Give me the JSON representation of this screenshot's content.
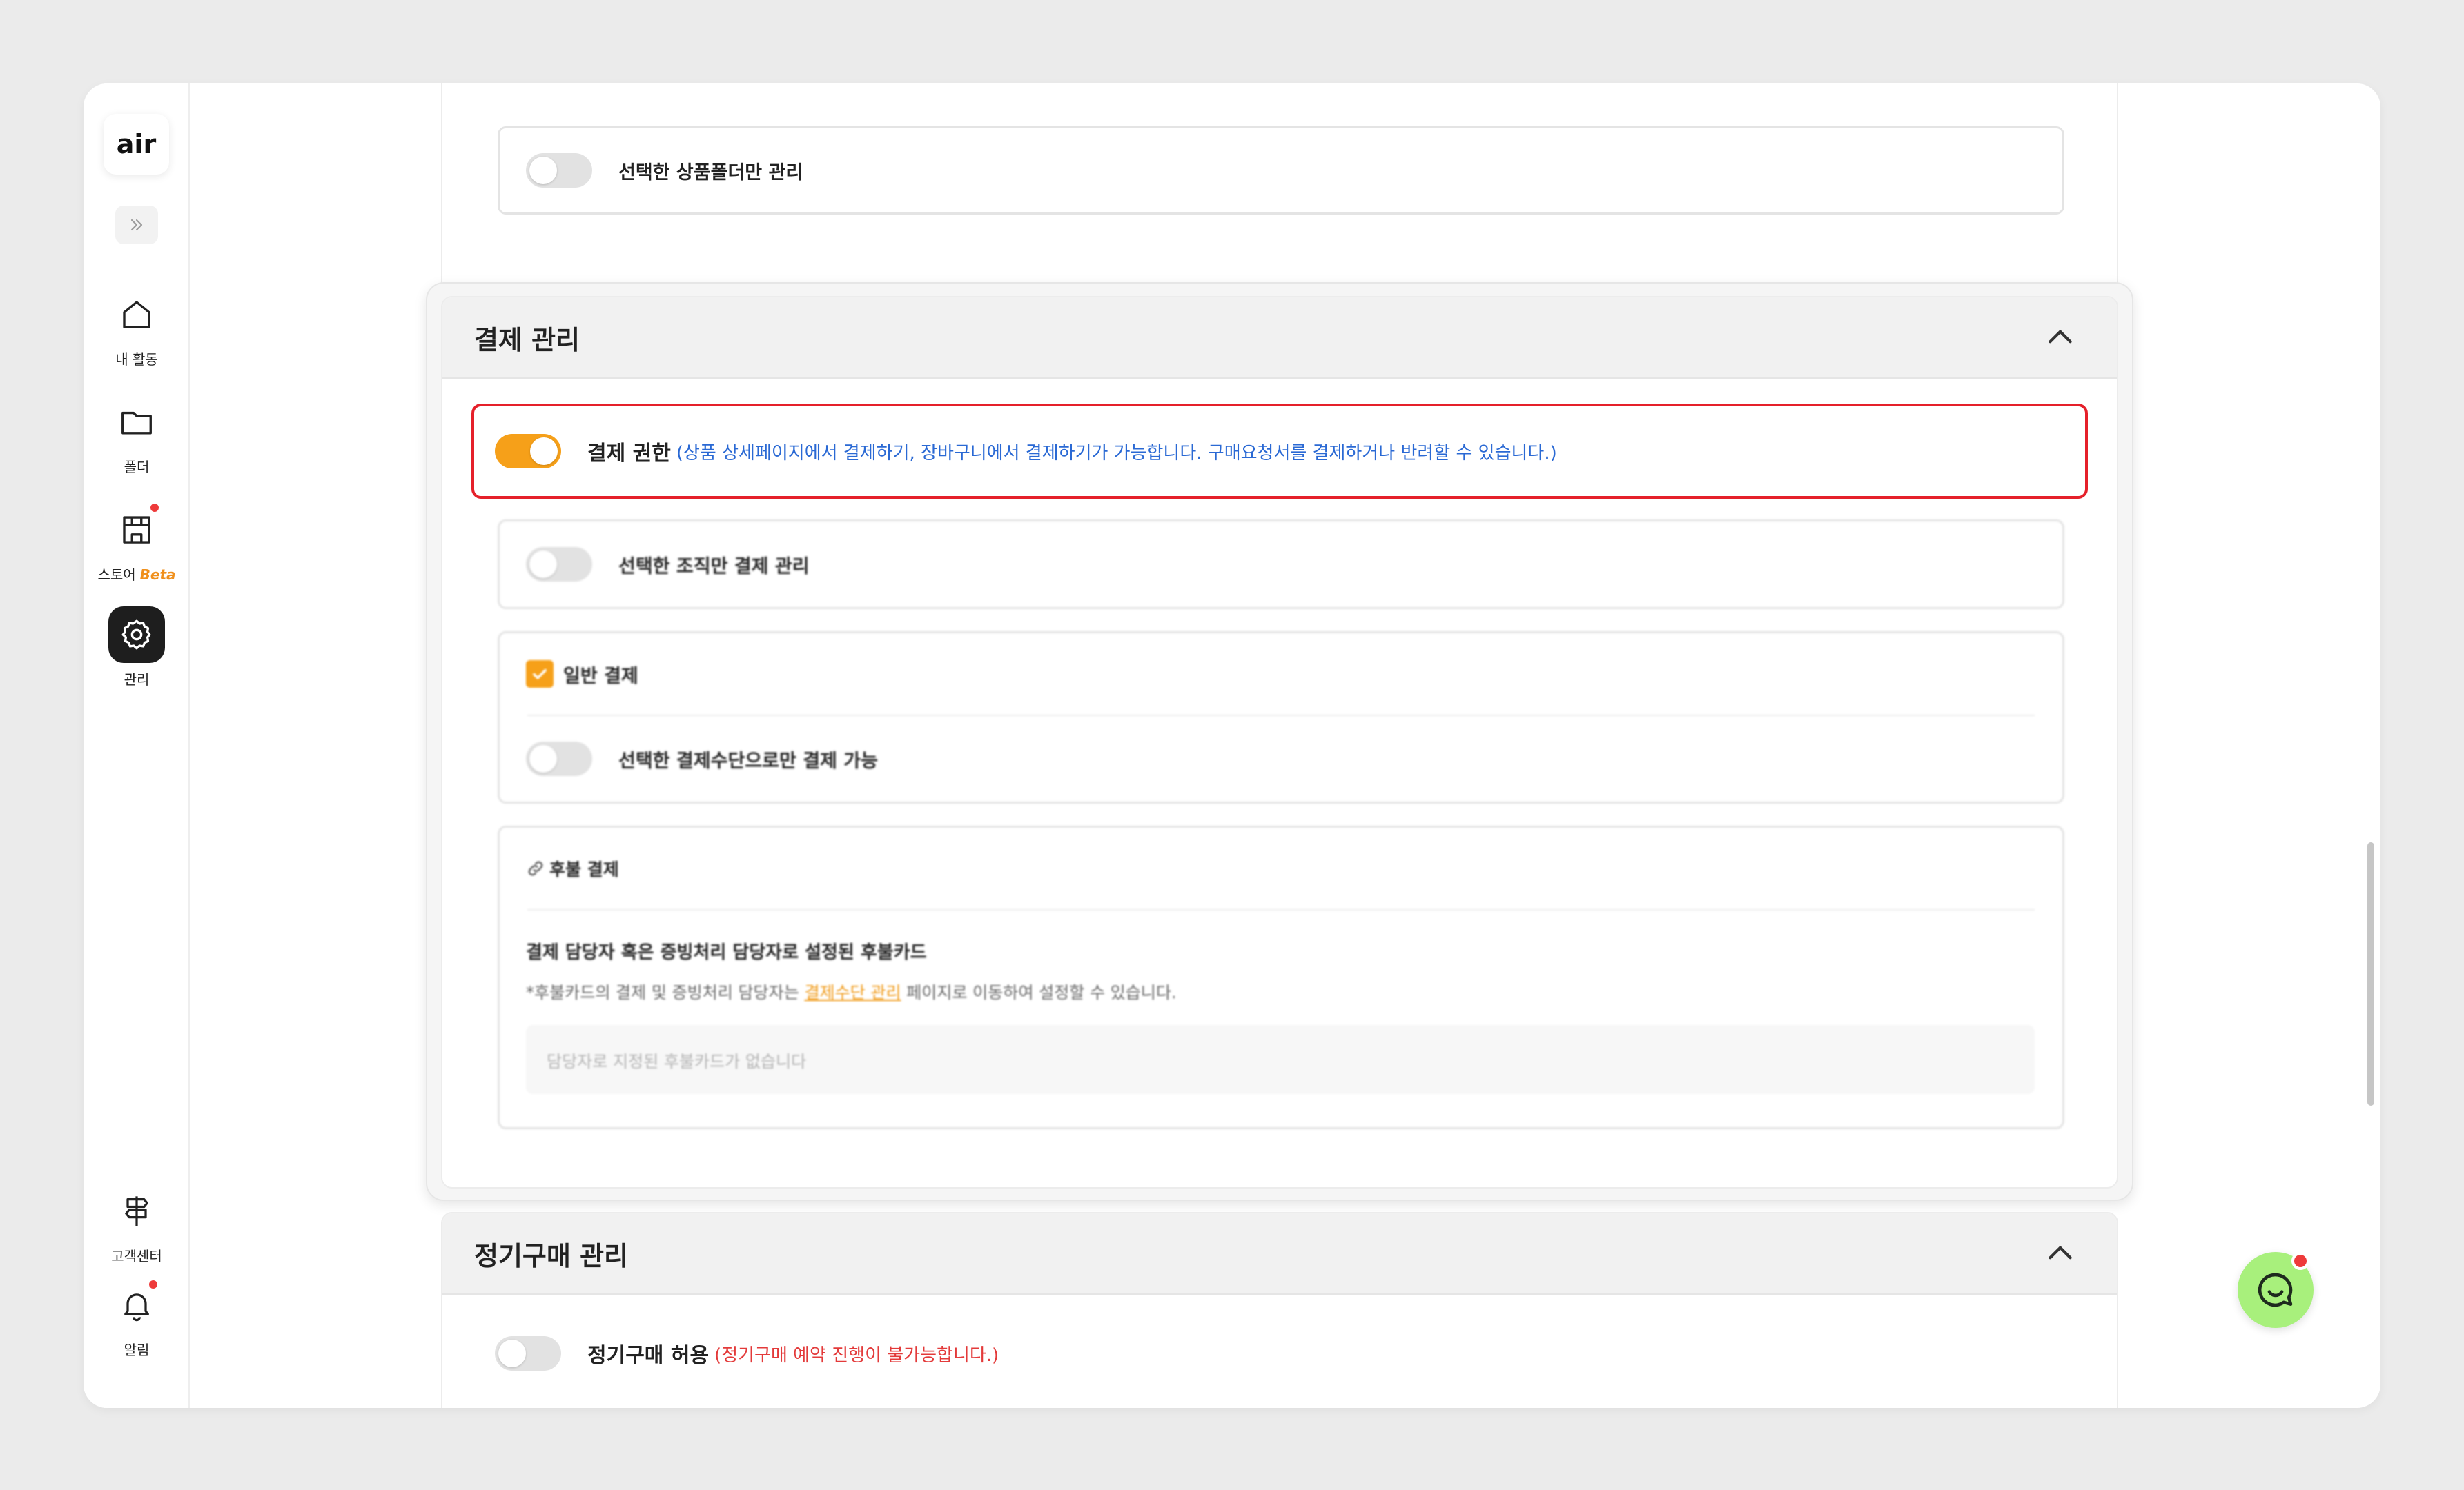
{
  "sidebar": {
    "logo": "air",
    "items": [
      {
        "label": "내 활동",
        "icon": "home-icon"
      },
      {
        "label": "폴더",
        "icon": "folder-icon"
      },
      {
        "label": "스토어",
        "badge": "Beta",
        "icon": "store-icon"
      },
      {
        "label": "관리",
        "icon": "settings-icon"
      }
    ],
    "bottom_items": [
      {
        "label": "고객센터",
        "icon": "signpost-icon"
      },
      {
        "label": "알림",
        "icon": "bell-icon"
      }
    ]
  },
  "prev_section": {
    "folder_toggle_label": "선택한 상품폴더만 관리",
    "folder_toggle_on": false
  },
  "payment_section": {
    "title": "결제 관리",
    "permission": {
      "label": "결제 권한",
      "note": "(상품 상세페이지에서 결제하기, 장바구니에서 결제하기가 가능합니다. 구매요청서를 결제하거나 반려할 수 있습니다.)",
      "on": true
    },
    "org_toggle_label": "선택한 조직만 결제 관리",
    "general_payment": {
      "label": "일반 결제",
      "checked": true,
      "method_toggle_label": "선택한 결제수단으로만 결제 가능"
    },
    "postpaid": {
      "title": "후불 결제",
      "subtitle": "결제 담당자 혹은 증빙처리 담당자로 설정된 후불카드",
      "note_prefix": "*후불카드의 결제 및 증빙처리 담당자는 ",
      "note_link": "결제수단 관리",
      "note_suffix": " 페이지로 이동하여 설정할 수 있습니다.",
      "empty_text": "담당자로 지정된 후불카드가 없습니다"
    }
  },
  "subscription_section": {
    "title": "정기구매 관리",
    "toggle_label": "정기구매 허용",
    "note": "(정기구매 예약 진행이 불가능합니다.)",
    "on": false
  },
  "colors": {
    "accent": "#f6a019",
    "highlight_border": "#e5202a",
    "link_blue": "#2a69d4",
    "warning_red": "#e33a3a",
    "chat_green": "#a8f07c"
  }
}
